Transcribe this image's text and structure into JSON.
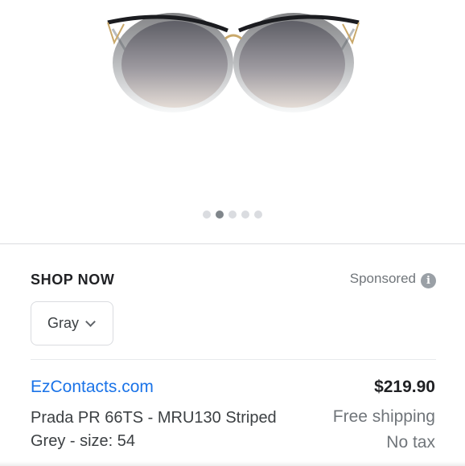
{
  "product_image": {
    "icon": "sunglasses-image",
    "active_index": 1,
    "total_images": 5
  },
  "section": {
    "heading": "SHOP NOW",
    "sponsored_label": "Sponsored",
    "info_icon": "info-icon"
  },
  "filter": {
    "selected": "Gray"
  },
  "listing": {
    "merchant": "EzContacts.com",
    "price": "$219.90",
    "title": "Prada PR 66TS - MRU130 Striped Grey - size: 54",
    "shipping": "Free shipping",
    "tax": "No tax"
  },
  "colors": {
    "link": "#1a73e8",
    "muted": "#70757a",
    "text": "#202124"
  }
}
